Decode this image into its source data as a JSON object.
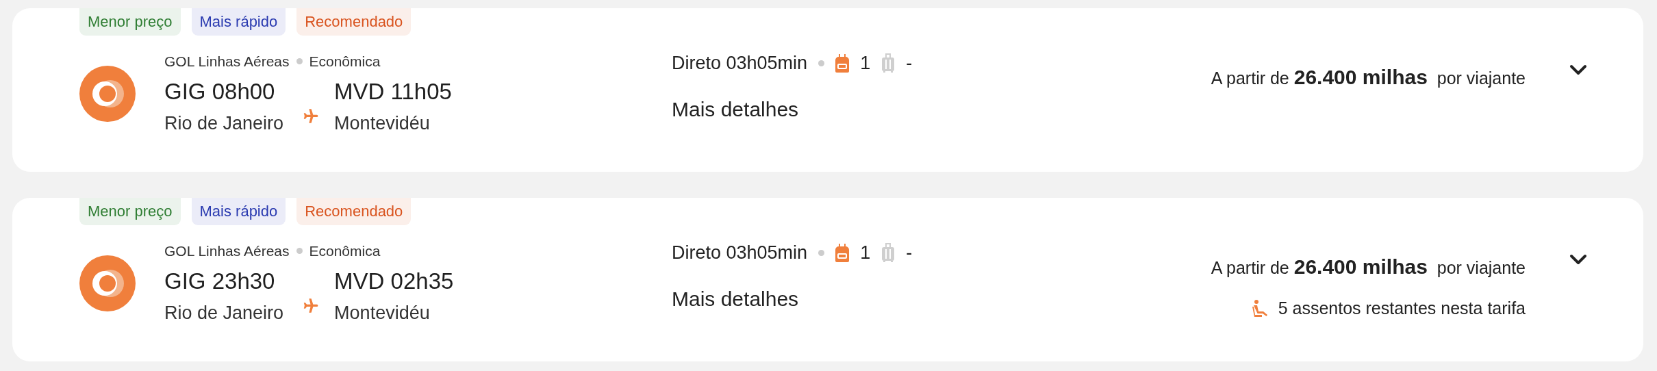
{
  "flights": [
    {
      "tags": [
        {
          "label": "Menor preço",
          "color": "#2e7d32"
        },
        {
          "label": "Mais rápido",
          "color": "#2a3ab0"
        },
        {
          "label": "Recomendado",
          "color": "#d9531e"
        }
      ],
      "airline": "GOL Linhas Aéreas",
      "cabin": "Econômica",
      "departure": {
        "time": "GIG 08h00",
        "city": "Rio de Janeiro"
      },
      "arrival": {
        "time": "MVD 11h05",
        "city": "Montevidéu"
      },
      "duration": "Direto 03h05min",
      "carry_on": {
        "count": "1",
        "included": true
      },
      "checked_bag": {
        "count": "-",
        "included": false
      },
      "details_link": "Mais detalhes",
      "price_prefix": "A partir de",
      "price": "26.400 milhas",
      "price_suffix": "por viajante",
      "expanded": false
    },
    {
      "tags": [
        {
          "label": "Menor preço",
          "color": "#2e7d32"
        },
        {
          "label": "Mais rápido",
          "color": "#2a3ab0"
        },
        {
          "label": "Recomendado",
          "color": "#d9531e"
        }
      ],
      "airline": "GOL Linhas Aéreas",
      "cabin": "Econômica",
      "departure": {
        "time": "GIG 23h30",
        "city": "Rio de Janeiro"
      },
      "arrival": {
        "time": "MVD 02h35",
        "city": "Montevidéu"
      },
      "duration": "Direto 03h05min",
      "carry_on": {
        "count": "1",
        "included": true
      },
      "checked_bag": {
        "count": "-",
        "included": false
      },
      "details_link": "Mais detalhes",
      "price_prefix": "A partir de",
      "price": "26.400 milhas",
      "price_suffix": "por viajante",
      "seats_notice": "5 assentos restantes nesta tarifa",
      "expanded": false
    }
  ]
}
